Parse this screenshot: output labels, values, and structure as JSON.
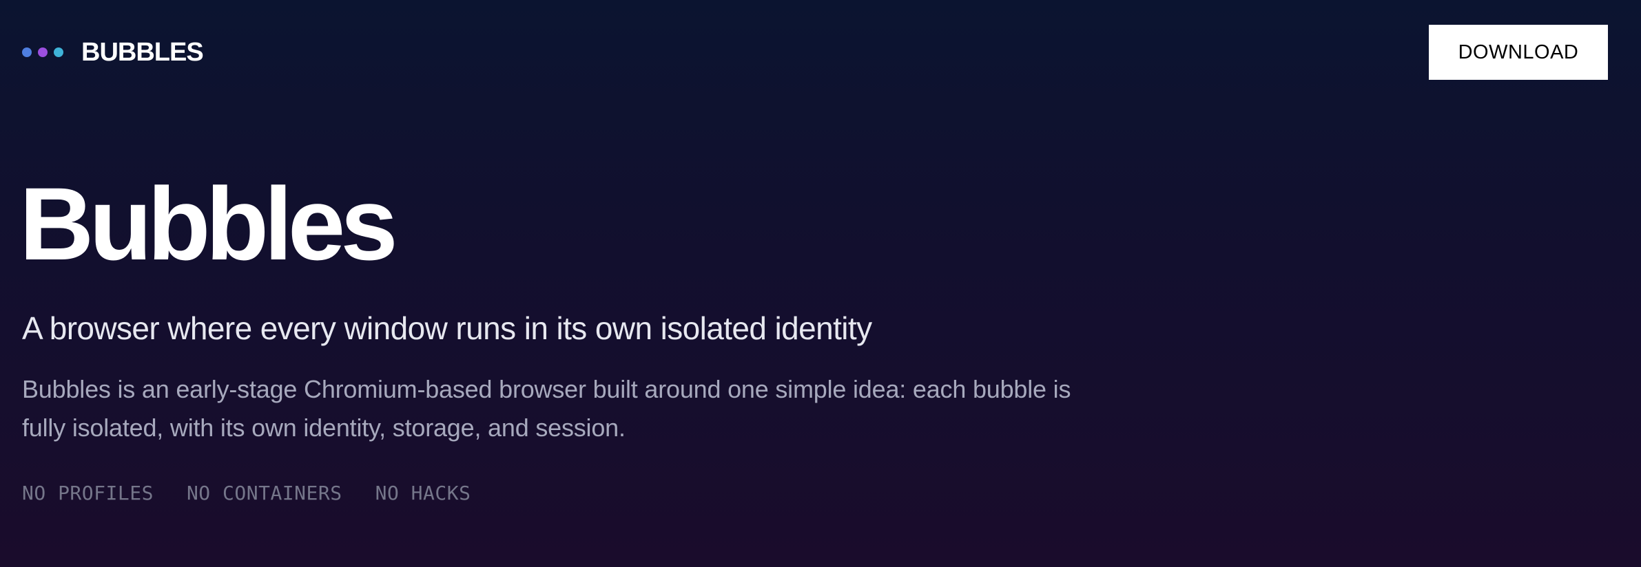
{
  "header": {
    "brand_name": "BUBBLES",
    "dots": [
      {
        "name": "blue-dot",
        "color": "#4f7fe0"
      },
      {
        "name": "purple-dot",
        "color": "#9b4fe0"
      },
      {
        "name": "cyan-dot",
        "color": "#3fb3d8"
      }
    ],
    "download_label": "DOWNLOAD"
  },
  "hero": {
    "title": "Bubbles",
    "subtitle": "A browser where every window runs in its own isolated identity",
    "description": "Bubbles is an early-stage Chromium-based browser built around one simple idea: each bubble is fully isolated, with its own identity, storage, and session.",
    "tags": [
      "NO PROFILES",
      "NO CONTAINERS",
      "NO HACKS"
    ]
  },
  "colors": {
    "background_top": "#0b1430",
    "background_bottom": "#1a0c2c",
    "button_background": "#ffffff",
    "button_text": "#000000",
    "subtitle_text": "#e7e8f0",
    "description_text": "#a7a9bd",
    "tag_text": "#75768a"
  }
}
